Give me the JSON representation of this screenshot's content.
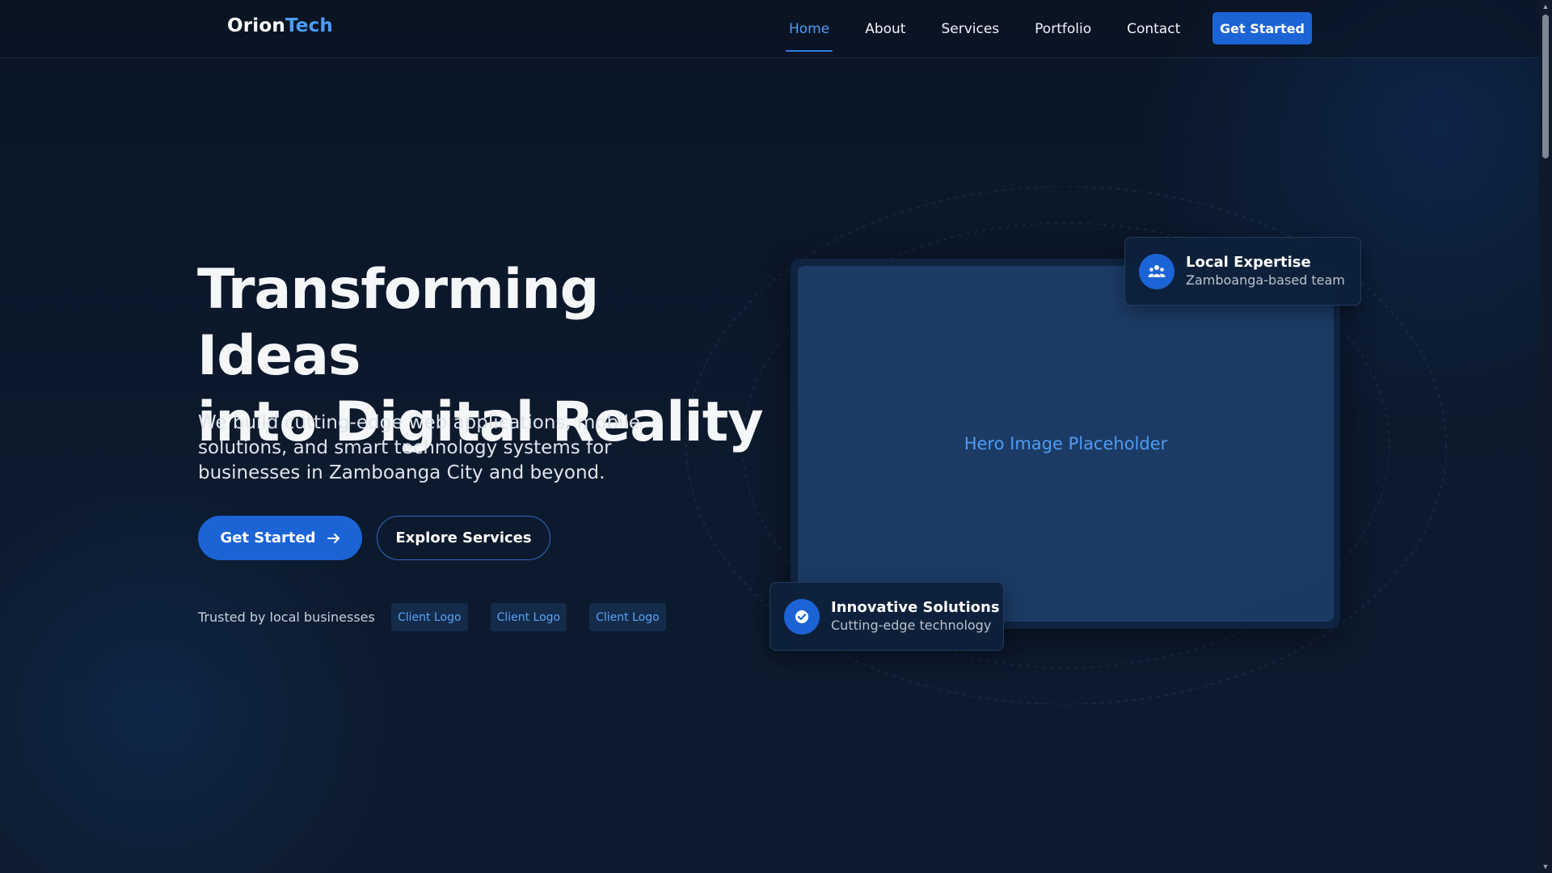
{
  "brand": {
    "name_part1": "Orion",
    "name_part2": "Tech",
    "accent_color": "#4d9cf6",
    "primary_color": "#1c64d6"
  },
  "nav": {
    "links": [
      {
        "label": "Home",
        "active": true
      },
      {
        "label": "About",
        "active": false
      },
      {
        "label": "Services",
        "active": false
      },
      {
        "label": "Portfolio",
        "active": false
      },
      {
        "label": "Contact",
        "active": false
      }
    ],
    "cta_label": "Get Started"
  },
  "hero": {
    "title_line1": "Transforming Ideas",
    "title_line2": "into Digital Reality",
    "subtitle": "We build cutting-edge web applications, mobile solutions, and smart technology systems for businesses in Zamboanga City and beyond.",
    "primary_button": {
      "label": "Get Started",
      "icon": "arrow-right-icon"
    },
    "secondary_button": {
      "label": "Explore Services"
    },
    "trusted_text": "Trusted by local businesses",
    "client_logos": [
      "Client Logo",
      "Client Logo",
      "Client Logo"
    ],
    "image_placeholder": "Hero Image Placeholder"
  },
  "cards": {
    "local": {
      "title": "Local Expertise",
      "subtitle": "Zamboanga-based team",
      "icon": "users-icon"
    },
    "innovation": {
      "title": "Innovative Solutions",
      "subtitle": "Cutting-edge technology",
      "icon": "check-circle-icon"
    }
  }
}
